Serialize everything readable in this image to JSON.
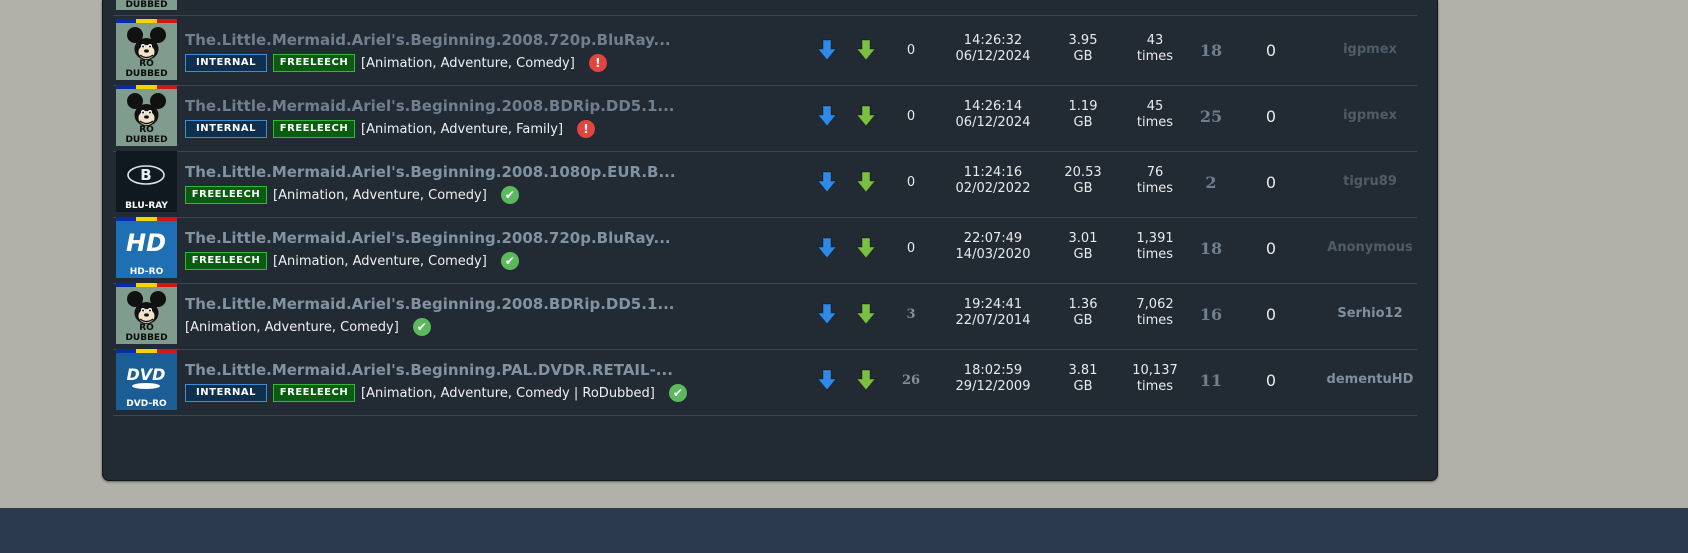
{
  "rows": [
    {
      "thumb": "rodubbed",
      "thumb_label_1": "RO",
      "thumb_label_2": "DUBBED",
      "title": "The.Little.Mermaid.Ariel's.Beginning.2008.720p.BluRay...",
      "badges": [
        "INTERNAL",
        "FREELEECH"
      ],
      "genres": "[Animation, Adventure, Comedy]",
      "status": "warn",
      "files": "0",
      "time": "14:26:32",
      "date": "06/12/2024",
      "size": "3.95",
      "size_unit": "GB",
      "snatched": "43",
      "snatched_unit": "times",
      "seeders": "18",
      "leechers": "0",
      "uploader": "igpmex"
    },
    {
      "thumb": "rodubbed",
      "thumb_label_1": "RO",
      "thumb_label_2": "DUBBED",
      "title": "The.Little.Mermaid.Ariel's.Beginning.2008.BDRip.DD5.1...",
      "badges": [
        "INTERNAL",
        "FREELEECH"
      ],
      "genres": "[Animation, Adventure, Family]",
      "status": "warn",
      "files": "0",
      "time": "14:26:14",
      "date": "06/12/2024",
      "size": "1.19",
      "size_unit": "GB",
      "snatched": "45",
      "snatched_unit": "times",
      "seeders": "25",
      "leechers": "0",
      "uploader": "igpmex"
    },
    {
      "thumb": "bluray",
      "thumb_label_1": "BLU-RAY",
      "thumb_label_2": "",
      "title": "The.Little.Mermaid.Ariel's.Beginning.2008.1080p.EUR.B...",
      "badges": [
        "FREELEECH"
      ],
      "genres": "[Animation, Adventure, Comedy]",
      "status": "ok",
      "files": "0",
      "time": "11:24:16",
      "date": "02/02/2022",
      "size": "20.53",
      "size_unit": "GB",
      "snatched": "76",
      "snatched_unit": "times",
      "seeders": "2",
      "leechers": "0",
      "uploader": "tigru89"
    },
    {
      "thumb": "hd",
      "thumb_label_1": "HD-RO",
      "thumb_label_2": "HD",
      "title": "The.Little.Mermaid.Ariel's.Beginning.2008.720p.BluRay...",
      "badges": [
        "FREELEECH"
      ],
      "genres": "[Animation, Adventure, Comedy]",
      "status": "ok",
      "files": "0",
      "time": "22:07:49",
      "date": "14/03/2020",
      "size": "3.01",
      "size_unit": "GB",
      "snatched": "1,391",
      "snatched_unit": "times",
      "seeders": "18",
      "leechers": "0",
      "uploader": "Anonymous"
    },
    {
      "thumb": "rodubbed",
      "thumb_label_1": "RO",
      "thumb_label_2": "DUBBED",
      "title": "The.Little.Mermaid.Ariel's.Beginning.2008.BDRip.DD5.1...",
      "badges": [],
      "genres": "[Animation, Adventure, Comedy]",
      "status": "ok",
      "files": "3",
      "time": "19:24:41",
      "date": "22/07/2014",
      "size": "1.36",
      "size_unit": "GB",
      "snatched": "7,062",
      "snatched_unit": "times",
      "seeders": "16",
      "leechers": "0",
      "uploader": "Serhio12"
    },
    {
      "thumb": "dvd",
      "thumb_label_1": "DVD-RO",
      "thumb_label_2": "DVD",
      "title": "The.Little.Mermaid.Ariel's.Beginning.PAL.DVDR.RETAIL-...",
      "badges": [
        "INTERNAL",
        "FREELEECH"
      ],
      "genres": "[Animation, Adventure, Comedy | RoDubbed]",
      "status": "ok",
      "files": "26",
      "time": "18:02:59",
      "date": "29/12/2009",
      "size": "3.81",
      "size_unit": "GB",
      "snatched": "10,137",
      "snatched_unit": "times",
      "seeders": "11",
      "leechers": "0",
      "uploader": "dementuHD"
    }
  ],
  "top_partial_label": "DUBBED",
  "colors": {
    "panel_bg": "#222a33",
    "page_bg": "#b1b1a9",
    "footer_bg": "#2b3a4d",
    "internal_border": "#3e8bd6",
    "freeleech_border": "#34b63a",
    "download_blue": "#2e8ae6",
    "download_green": "#7bc043",
    "ok_green": "#5cb85c",
    "warn_red": "#e0463f"
  },
  "icons": {
    "download": "download-arrow-icon",
    "bookmark": "download-green-arrow-icon",
    "ok": "check-circle-icon",
    "warn": "exclamation-circle-icon"
  }
}
